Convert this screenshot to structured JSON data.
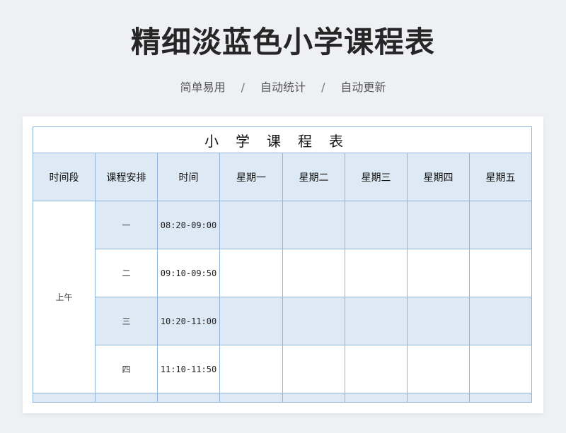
{
  "header": {
    "title": "精细淡蓝色小学课程表",
    "tags": [
      "简单易用",
      "自动统计",
      "自动更新"
    ],
    "separator": "/"
  },
  "schedule": {
    "title": "小学课程表",
    "columns": [
      "时间段",
      "课程安排",
      "时间",
      "星期一",
      "星期二",
      "星期三",
      "星期四",
      "星期五"
    ],
    "period": "上午",
    "rows": [
      {
        "num": "一",
        "time": "08:20-09:00",
        "shaded": true
      },
      {
        "num": "二",
        "time": "09:10-09:50",
        "shaded": false
      },
      {
        "num": "三",
        "time": "10:20-11:00",
        "shaded": true
      },
      {
        "num": "四",
        "time": "11:10-11:50",
        "shaded": false
      }
    ]
  }
}
